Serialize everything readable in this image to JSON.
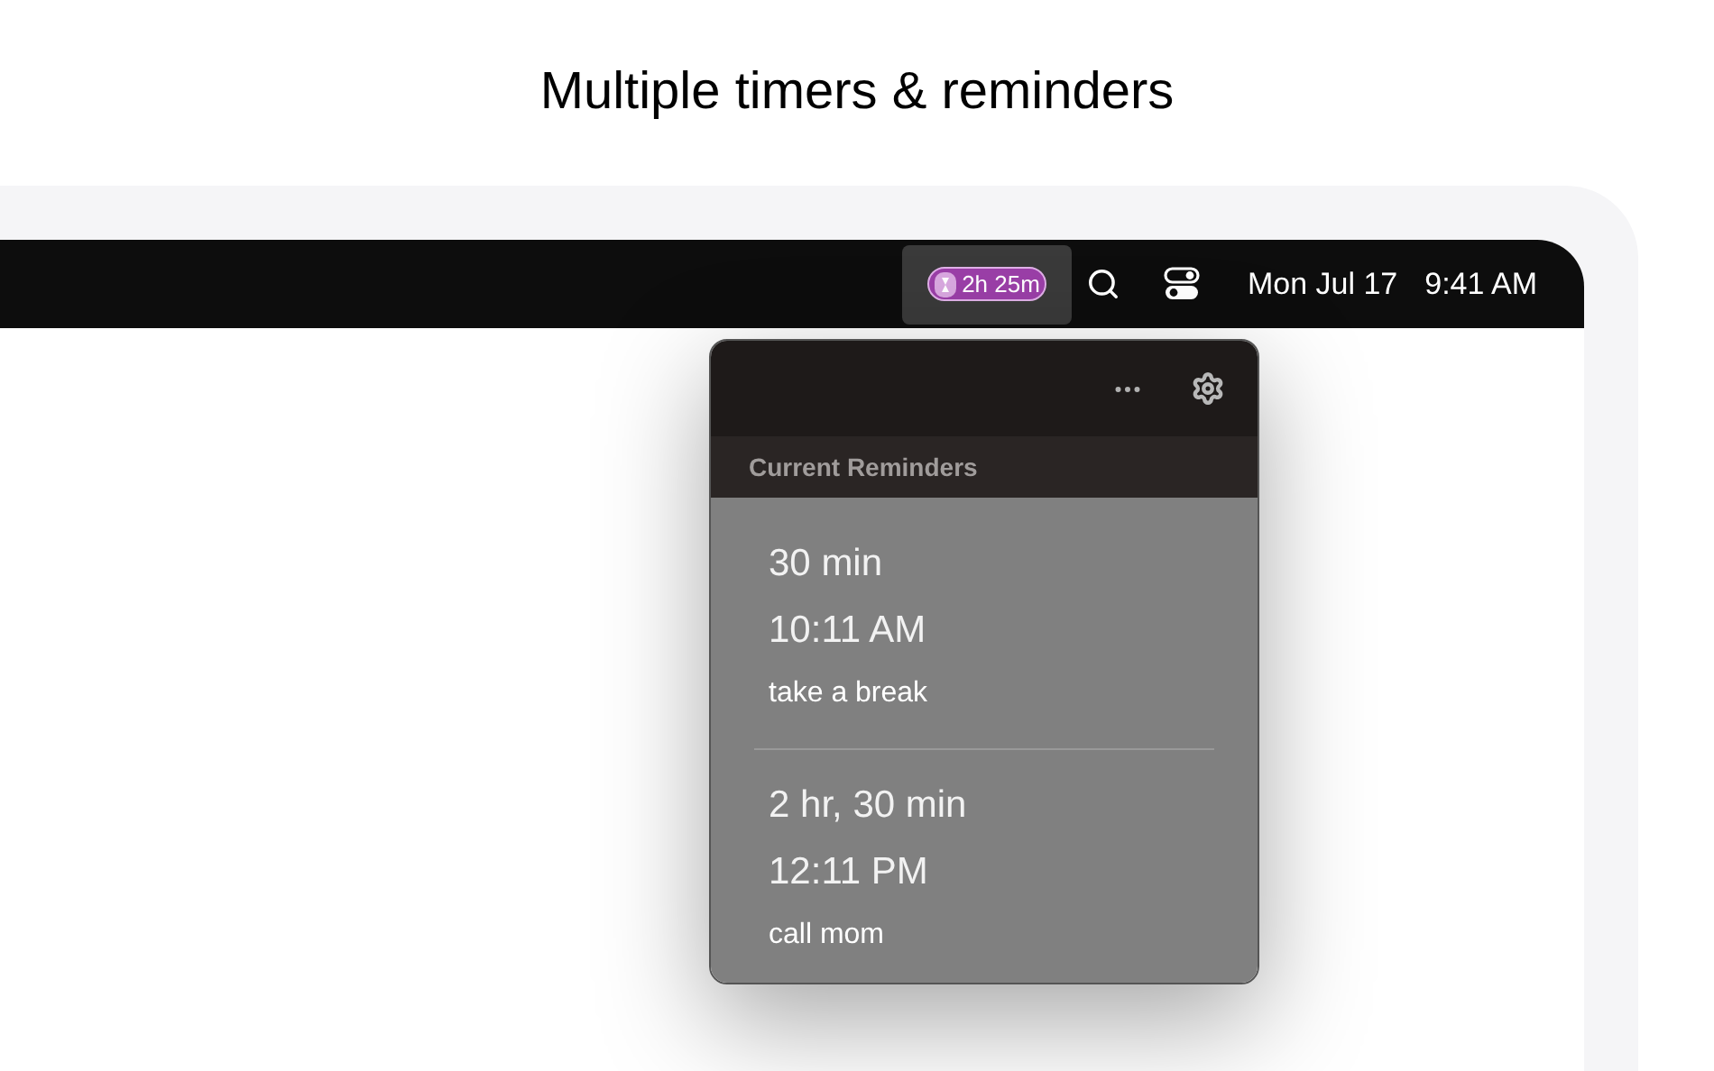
{
  "headline": "Multiple timers & reminders",
  "menu_bar": {
    "timer_badge": "2h 25m",
    "timer_active": true,
    "date": "Mon Jul 17",
    "time": "9:41 AM"
  },
  "popover": {
    "section_title": "Current Reminders",
    "reminders": [
      {
        "duration": "30 min",
        "time": "10:11 AM",
        "note": "take a break"
      },
      {
        "duration": "2 hr, 30 min",
        "time": "12:11 PM",
        "note": "call mom"
      }
    ]
  }
}
